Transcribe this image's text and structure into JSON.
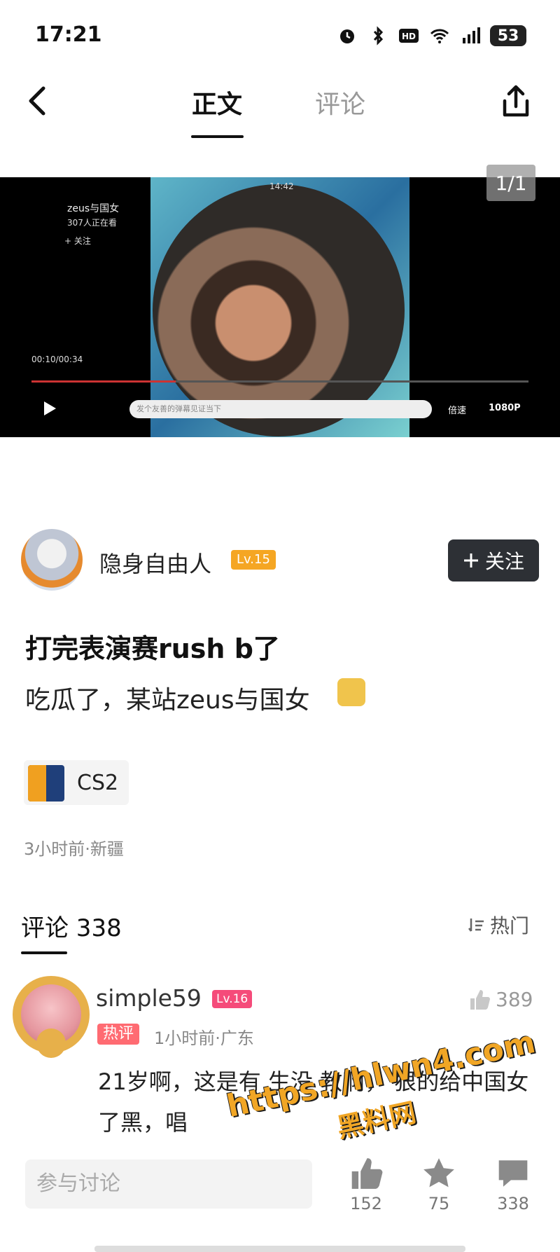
{
  "status_bar": {
    "time": "17:21",
    "battery": "53"
  },
  "nav": {
    "tab_main": "正文",
    "tab_comments": "评论"
  },
  "media": {
    "counter": "1/1",
    "video_title": "zeus与国女",
    "video_viewers": "307人正在看",
    "video_follow": "+ 关注",
    "video_clock": "14:42",
    "video_elapsed": "00:10/00:34",
    "video_progress": 0.29,
    "danmu_placeholder": "发个友善的弹幕见证当下",
    "speed_label": "倍速",
    "quality_label": "1080P"
  },
  "author": {
    "name": "隐身自由人",
    "level": "Lv.15",
    "follow_label": "关注"
  },
  "post": {
    "title": "打完表演赛rush b了",
    "body": "吃瓜了，某站zeus与国女",
    "topic": "CS2",
    "meta": "3小时前·新疆"
  },
  "comments": {
    "header": "评论 338",
    "sort_label": "热门",
    "items": [
      {
        "user": "simple59",
        "level": "Lv.16",
        "likes": "389",
        "tag": "热评",
        "meta": "1小时前·广东",
        "text": "21岁啊，这是有  生没  教啊，  狠的给中国女  了黑，唱"
      }
    ]
  },
  "watermark": {
    "line1": "https://hlwn4.com",
    "line2": "黑料网"
  },
  "bottom_bar": {
    "input_placeholder": "参与讨论",
    "like_count": "152",
    "star_count": "75",
    "comment_count": "338"
  },
  "colors": {
    "accent_orange": "#f5a623",
    "level_pink": "#f54b7a",
    "hot_tag": "#ff6b72",
    "follow_bg": "#2d3035"
  }
}
